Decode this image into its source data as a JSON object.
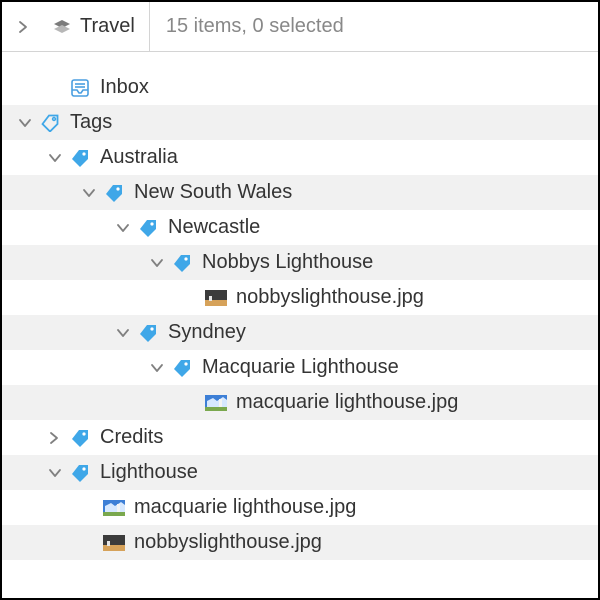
{
  "header": {
    "title": "Travel",
    "status": "15 items, 0 selected"
  },
  "tree": {
    "inbox_label": "Inbox",
    "tags_label": "Tags",
    "australia": "Australia",
    "nsw": "New South Wales",
    "newcastle": "Newcastle",
    "nobbys": "Nobbys Lighthouse",
    "nobbys_file": "nobbyslighthouse.jpg",
    "sydney": "Syndney",
    "macquarie": "Macquarie Lighthouse",
    "macquarie_file": "macquarie lighthouse.jpg",
    "credits": "Credits",
    "lighthouse": "Lighthouse",
    "lighthouse_file1": "macquarie lighthouse.jpg",
    "lighthouse_file2": "nobbyslighthouse.jpg"
  },
  "colors": {
    "tag_blue": "#3fa7e8",
    "inbox_blue": "#4a9ee0",
    "chevron_gray": "#808080"
  }
}
